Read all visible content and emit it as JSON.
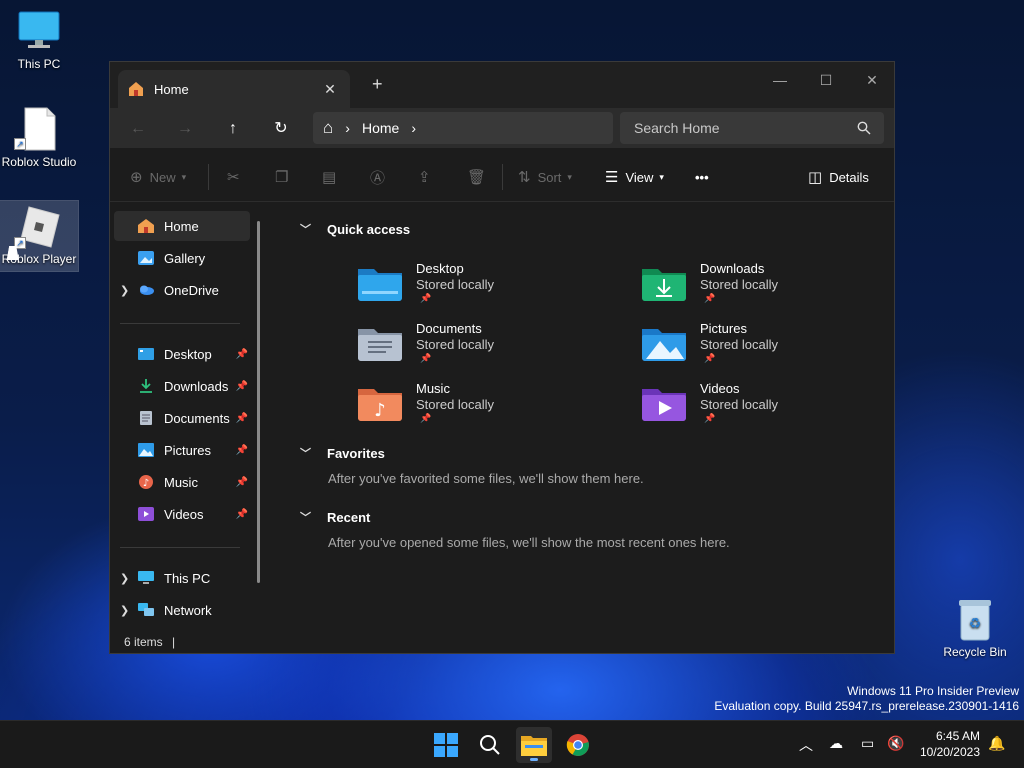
{
  "desktop": {
    "icons": [
      {
        "label": "This PC"
      },
      {
        "label": "Roblox Studio"
      },
      {
        "label": "Roblox Player"
      },
      {
        "label": "Recycle Bin"
      }
    ],
    "watermark": {
      "line1": "Windows 11 Pro Insider Preview",
      "line2": "Evaluation copy. Build 25947.rs_prerelease.230901-1416"
    }
  },
  "window": {
    "tab_title": "Home",
    "tab_close": "✕",
    "new_tab": "+",
    "controls": {
      "minimize": "—",
      "maximize": "☐",
      "close": "✕"
    },
    "nav": {
      "back": "←",
      "forward": "→",
      "up": "↑",
      "refresh": "↻"
    },
    "address": {
      "home_glyph": "⌂",
      "sep": "›",
      "location": "Home",
      "sep2": "›"
    },
    "search": {
      "placeholder": "Search Home"
    },
    "commands": {
      "new_label": "New",
      "sort_label": "Sort",
      "view_label": "View",
      "more_label": "•••",
      "details_label": "Details"
    },
    "sidebar": {
      "top_items": [
        {
          "label": "Home",
          "icon": "home-icon",
          "selected": true
        },
        {
          "label": "Gallery",
          "icon": "gallery-icon"
        },
        {
          "label": "OneDrive",
          "icon": "onedrive-icon"
        }
      ],
      "pinned_items": [
        {
          "label": "Desktop",
          "icon": "desktop-icon"
        },
        {
          "label": "Downloads",
          "icon": "download-icon"
        },
        {
          "label": "Documents",
          "icon": "document-icon"
        },
        {
          "label": "Pictures",
          "icon": "pictures-icon"
        },
        {
          "label": "Music",
          "icon": "music-icon"
        },
        {
          "label": "Videos",
          "icon": "videos-icon"
        }
      ],
      "bottom_items": [
        {
          "label": "This PC",
          "icon": "pc-icon"
        },
        {
          "label": "Network",
          "icon": "network-icon"
        }
      ]
    },
    "content": {
      "quick_access": {
        "heading": "Quick access",
        "items": [
          {
            "name": "Desktop",
            "sub": "Stored locally",
            "color": "#2f9fe6"
          },
          {
            "name": "Downloads",
            "sub": "Stored locally",
            "color": "#1fae6a"
          },
          {
            "name": "Documents",
            "sub": "Stored locally",
            "color": "#a9b5c6"
          },
          {
            "name": "Pictures",
            "sub": "Stored locally",
            "color": "#2e9be8"
          },
          {
            "name": "Music",
            "sub": "Stored locally",
            "color": "#f0805a"
          },
          {
            "name": "Videos",
            "sub": "Stored locally",
            "color": "#8e4fd8"
          }
        ]
      },
      "favorites": {
        "heading": "Favorites",
        "message": "After you've favorited some files, we'll show them here."
      },
      "recent": {
        "heading": "Recent",
        "message": "After you've opened some files, we'll show the most recent ones here."
      }
    },
    "status": {
      "items": "6 items"
    }
  },
  "taskbar": {
    "time": "6:45 AM",
    "date": "10/20/2023"
  }
}
